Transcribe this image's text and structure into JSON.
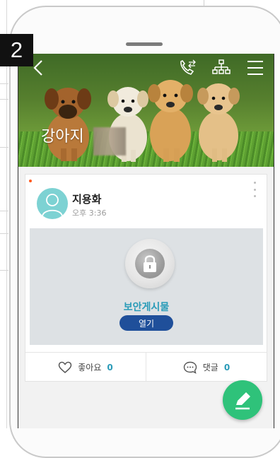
{
  "step_badge": "2",
  "header": {
    "title": "강아지",
    "back_icon": "chevron-left-icon",
    "call_icon": "phone-transfer-icon",
    "org_icon": "org-chart-icon",
    "menu_icon": "hamburger-menu-icon"
  },
  "post": {
    "author": "지용화",
    "time": "오후 3:36",
    "secure_label": "보안게시물",
    "open_button": "열기",
    "like_label": "좋아요",
    "like_count": "0",
    "comment_label": "댓글",
    "comment_count": "0"
  },
  "colors": {
    "accent": "#2a9bb8",
    "button": "#1f4f9a",
    "fab": "#2fc27a",
    "new_dot": "#ff5a1f"
  }
}
